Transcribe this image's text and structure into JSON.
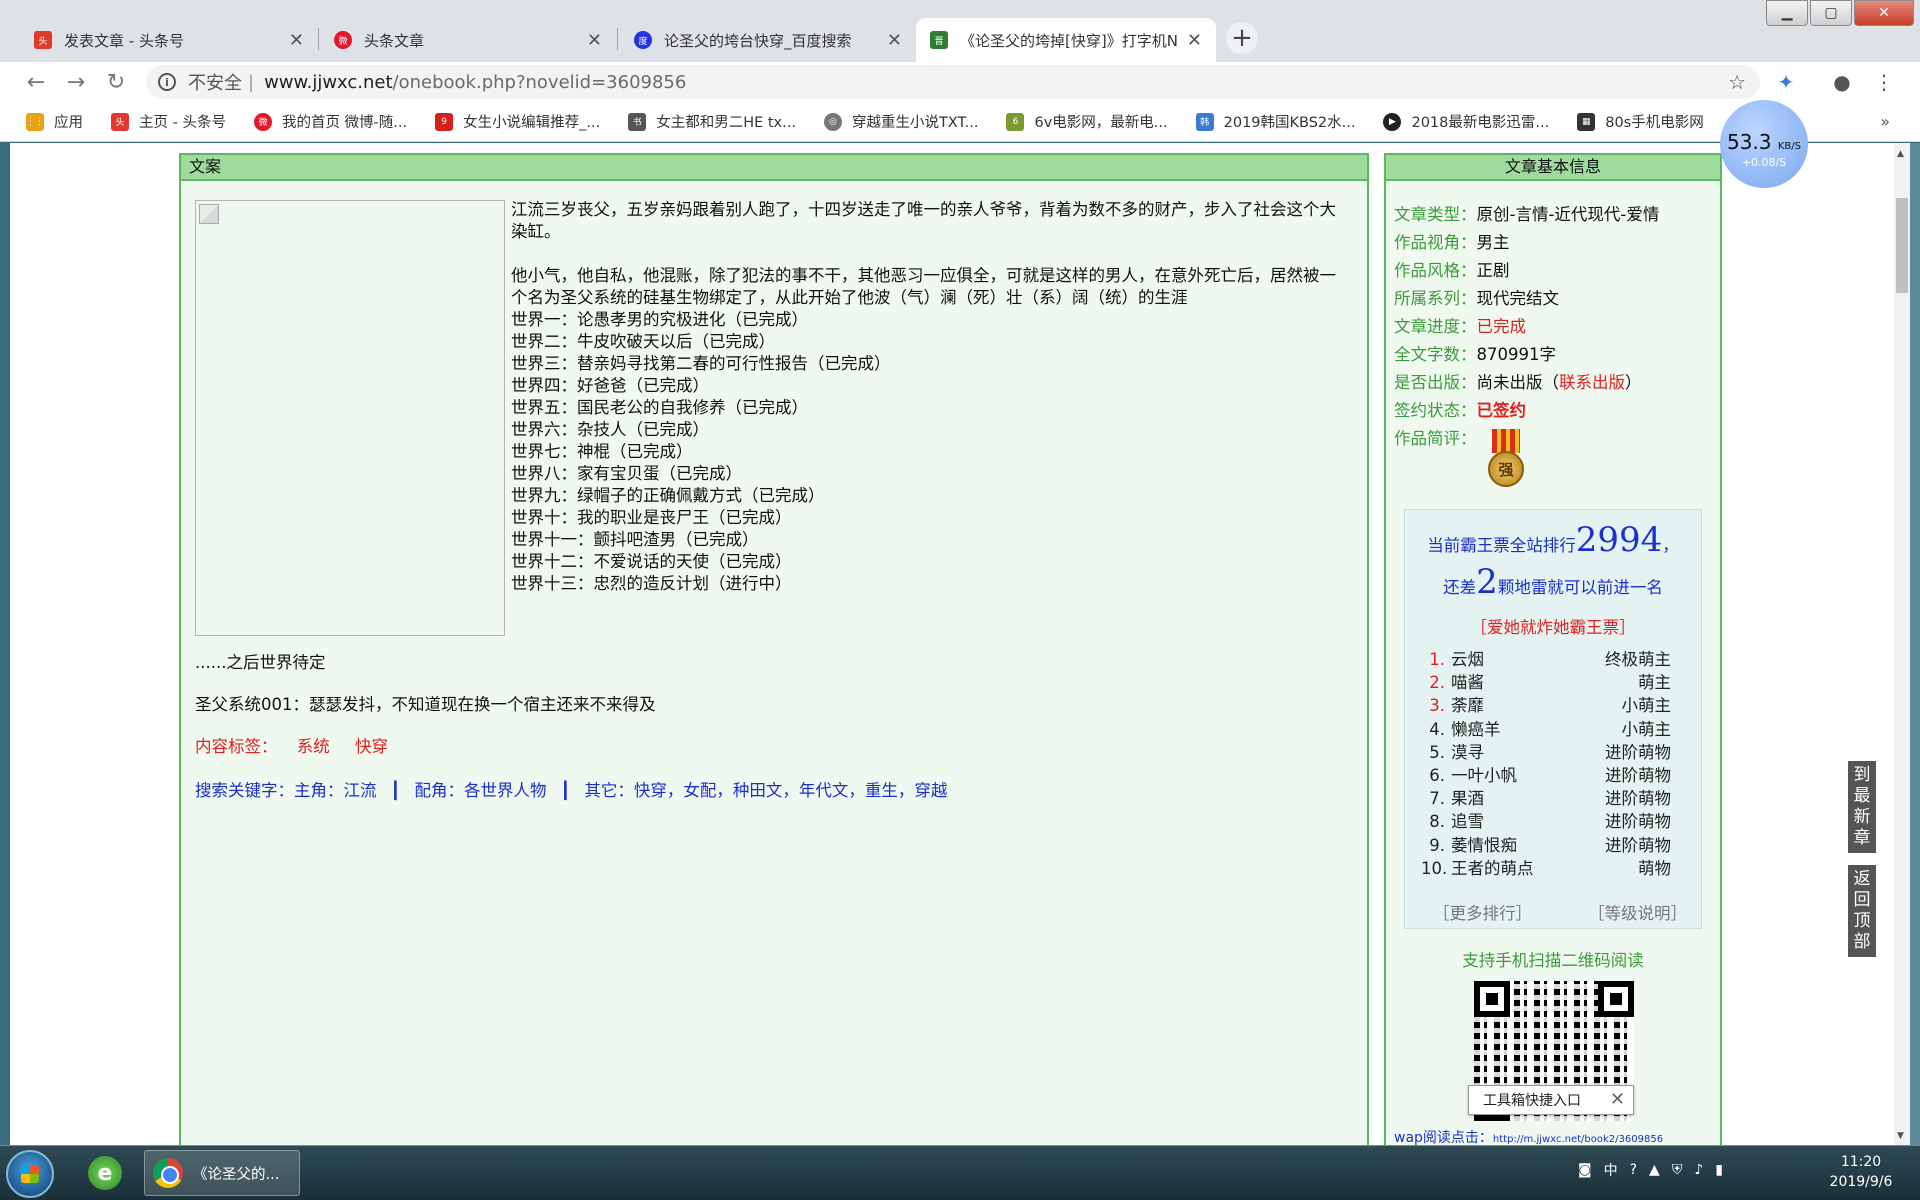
{
  "window": {
    "minimize": "▁",
    "maximize": "▢",
    "close": "✕"
  },
  "tabs": [
    {
      "title": "发表文章 - 头条号",
      "favicon": "toutiao-icon",
      "color": "#e0392e"
    },
    {
      "title": "头条文章",
      "favicon": "weibo-icon",
      "color": "#e6162d"
    },
    {
      "title": "论圣父的垮台快穿_百度搜索",
      "favicon": "baidu-icon",
      "color": "#2932e1"
    },
    {
      "title": "《论圣父的垮掉[快穿]》打字机N",
      "favicon": "jjwxc-icon",
      "color": "#2e7d32"
    }
  ],
  "toolbar": {
    "insecure": "不安全",
    "url_host": "www.jjwxc.net",
    "url_path": "/onebook.php?novelid=3609856"
  },
  "bookmarks": [
    {
      "label": "应用",
      "icon": "apps-icon",
      "color": "#e8a317"
    },
    {
      "label": "主页 - 头条号",
      "icon": "toutiao-icon",
      "color": "#e0392e"
    },
    {
      "label": "我的首页 微博-随...",
      "icon": "weibo-icon",
      "color": "#e6162d"
    },
    {
      "label": "女生小说编辑推荐_...",
      "icon": "book-icon",
      "color": "#d62020"
    },
    {
      "label": "女主都和男二HE tx...",
      "icon": "book-icon",
      "color": "#555555"
    },
    {
      "label": "穿越重生小说TXT...",
      "icon": "globe-icon",
      "color": "#777777"
    },
    {
      "label": "6v电影网，最新电...",
      "icon": "film-icon",
      "color": "#7a9a30"
    },
    {
      "label": "2019韩国KBS2水...",
      "icon": "tv-icon",
      "color": "#3a7bd5"
    },
    {
      "label": "2018最新电影迅雷...",
      "icon": "play-icon",
      "color": "#222222"
    },
    {
      "label": "80s手机电影网",
      "icon": "film-icon",
      "color": "#333333"
    }
  ],
  "bookmarks_more": "»",
  "speed": {
    "value": "53.3",
    "unit": "KB/S",
    "sub": "+0.08/S"
  },
  "main_panel": {
    "header": "文案",
    "intro_line1": "江流三岁丧父，五岁亲妈跟着别人跑了，十四岁送走了唯一的亲人爷爷，背着为数不多的财产，步入了社会这个大染缸。",
    "intro_line2": "他小气，他自私，他混账，除了犯法的事不干，其他恶习一应俱全，可就是这样的男人，在意外死亡后，居然被一个名为圣父系统的硅基生物绑定了，从此开始了他波（气）澜（死）壮（系）阔（统）的生涯",
    "worlds": [
      "世界一：论愚孝男的究极进化（已完成）",
      "世界二：牛皮吹破天以后（已完成）",
      "世界三：替亲妈寻找第二春的可行性报告（已完成）",
      "世界四：好爸爸（已完成）",
      "世界五：国民老公的自我修养（已完成）",
      "世界六：杂技人（已完成）",
      "世界七：神棍（已完成）",
      "世界八：家有宝贝蛋（已完成）",
      "世界九：绿帽子的正确佩戴方式（已完成）",
      "世界十：我的职业是丧尸王（已完成）",
      "世界十一：颤抖吧渣男（已完成）",
      "世界十二：不爱说话的天使（已完成）",
      "世界十三：忠烈的造反计划（进行中）"
    ],
    "after": "......之后世界待定",
    "system_line": "圣父系统001：瑟瑟发抖，不知道现在换一个宿主还来不来得及",
    "tags_label": "内容标签：",
    "tags": [
      "系统",
      "快穿"
    ],
    "kw_label": "搜索关键字：主角：江流",
    "kw_bar": "┃",
    "kw_side": "配角：各世界人物",
    "kw_other": "其它：快穿，女配，种田文，年代文，重生，穿越"
  },
  "side_panel": {
    "header": "文章基本信息",
    "rows": [
      {
        "k": "文章类型：",
        "v": "原创-言情-近代现代-爱情"
      },
      {
        "k": "作品视角：",
        "v": "男主"
      },
      {
        "k": "作品风格：",
        "v": "正剧"
      },
      {
        "k": "所属系列：",
        "v": "现代完结文"
      },
      {
        "k": "文章进度：",
        "v": "已完成"
      },
      {
        "k": "全文字数：",
        "v": "870991字"
      },
      {
        "k": "是否出版：",
        "v": "尚未出版（",
        "link": "联系出版",
        "tail": "）"
      },
      {
        "k": "签约状态：",
        "v": "已签约"
      },
      {
        "k": "作品简评：",
        "v": ""
      }
    ],
    "medal_char": "强",
    "rank_pre": "当前霸王票全站排行",
    "rank_num": "2994",
    "rank_post": "，",
    "diff_pre": "还差",
    "diff_num": "2",
    "diff_post": "颗地雷就可以前进一名",
    "bomb": "［爱她就炸她霸王票］",
    "ranking": [
      {
        "no": "1.",
        "name": "云烟",
        "level": "终极萌主"
      },
      {
        "no": "2.",
        "name": "喵酱",
        "level": "萌主"
      },
      {
        "no": "3.",
        "name": "荼靡",
        "level": "小萌主"
      },
      {
        "no": "4.",
        "name": "懒癌羊",
        "level": "小萌主"
      },
      {
        "no": "5.",
        "name": "漠寻",
        "level": "进阶萌物"
      },
      {
        "no": "6.",
        "name": "一叶小帆",
        "level": "进阶萌物"
      },
      {
        "no": "7.",
        "name": "果酒",
        "level": "进阶萌物"
      },
      {
        "no": "8.",
        "name": "追雪",
        "level": "进阶萌物"
      },
      {
        "no": "9.",
        "name": "萎情恨痴",
        "level": "进阶萌物"
      },
      {
        "no": "10.",
        "name": "王者的萌点",
        "level": "萌物"
      }
    ],
    "more_rank": "［更多排行］",
    "level_note": "［等级说明］",
    "scan": "支持手机扫描二维码阅读",
    "toolbox": "工具箱快捷入口",
    "wap_label": "wap阅读点击：",
    "wap_url": "http://m.jjwxc.net/book2/3609856"
  },
  "float": {
    "latest": "到最新章",
    "top": "返回顶部"
  },
  "taskbar": {
    "chrome_title": "《论圣父的...",
    "tray_ime": "中",
    "time": "11:20",
    "date": "2019/9/6"
  }
}
